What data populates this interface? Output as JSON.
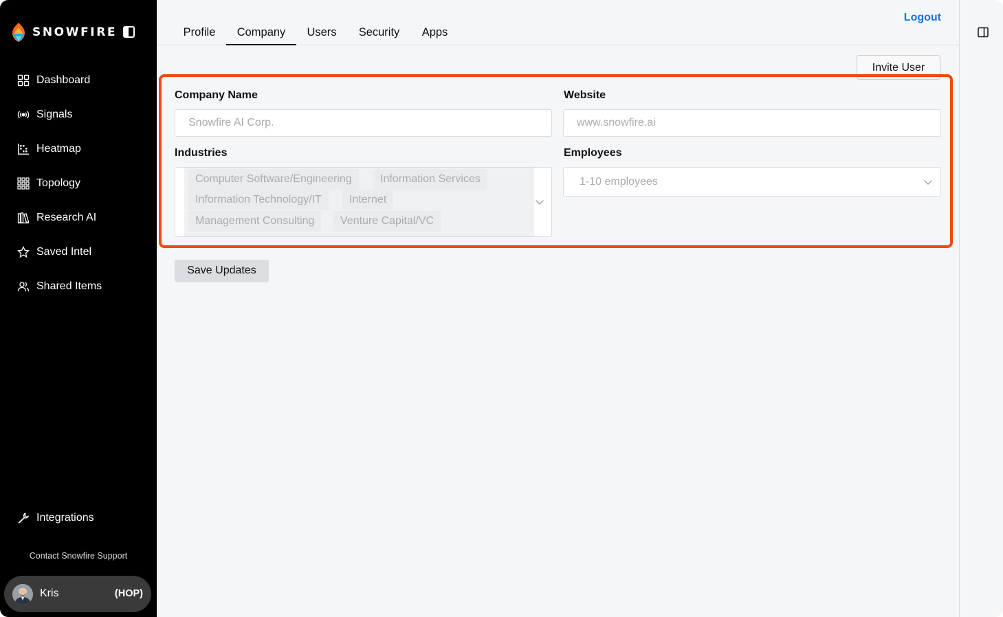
{
  "brand": {
    "name": "SNOWFIRE"
  },
  "sidebar": {
    "items": [
      {
        "label": "Dashboard",
        "icon": "grid-icon"
      },
      {
        "label": "Signals",
        "icon": "broadcast-icon"
      },
      {
        "label": "Heatmap",
        "icon": "heatmap-icon"
      },
      {
        "label": "Topology",
        "icon": "topology-icon"
      },
      {
        "label": "Research AI",
        "icon": "library-icon"
      },
      {
        "label": "Saved Intel",
        "icon": "star-icon"
      },
      {
        "label": "Shared Items",
        "icon": "users-icon"
      }
    ],
    "integrations": {
      "label": "Integrations",
      "icon": "wrench-icon"
    },
    "support": "Contact Snowfire Support",
    "user": {
      "name": "Kris",
      "org": "(HOP)"
    }
  },
  "header": {
    "tabs": [
      {
        "label": "Profile",
        "active": false
      },
      {
        "label": "Company",
        "active": true
      },
      {
        "label": "Users",
        "active": false
      },
      {
        "label": "Security",
        "active": false
      },
      {
        "label": "Apps",
        "active": false
      }
    ],
    "logout": "Logout"
  },
  "actions": {
    "invite": "Invite User",
    "save": "Save Updates"
  },
  "form": {
    "company_name": {
      "label": "Company Name",
      "placeholder": "Snowfire AI Corp."
    },
    "website": {
      "label": "Website",
      "placeholder": "www.snowfire.ai"
    },
    "industries": {
      "label": "Industries",
      "selected": [
        "Computer Software/Engineering",
        "Information Services",
        "Information Technology/IT",
        "Internet",
        "Management Consulting",
        "Venture Capital/VC"
      ]
    },
    "employees": {
      "label": "Employees",
      "value": "1-10 employees"
    }
  },
  "colors": {
    "accent_link": "#1a73e8",
    "highlight_border": "#f04a10",
    "sidebar_bg": "#000000"
  }
}
